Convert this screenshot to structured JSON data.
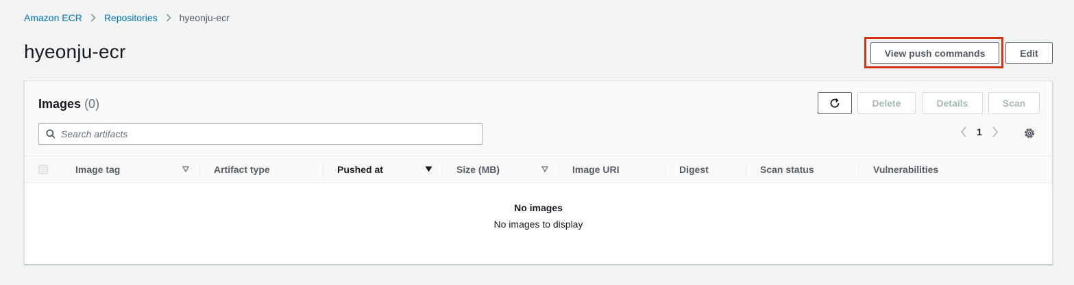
{
  "breadcrumb": [
    "Amazon ECR",
    "Repositories",
    "hyeonju-ecr"
  ],
  "page_title": "hyeonju-ecr",
  "actions": {
    "view_push_commands": "View push commands",
    "edit": "Edit"
  },
  "panel": {
    "title": "Images",
    "count": "(0)",
    "buttons": {
      "refresh": "refresh-icon",
      "delete": "Delete",
      "details": "Details",
      "scan": "Scan"
    },
    "search_placeholder": "Search artifacts",
    "pagination": {
      "page": "1"
    },
    "columns": [
      "Image tag",
      "Artifact type",
      "Pushed at",
      "Size (MB)",
      "Image URI",
      "Digest",
      "Scan status",
      "Vulnerabilities"
    ],
    "empty_title": "No images",
    "empty_text": "No images to display"
  },
  "colors": {
    "link": "#0073bb",
    "highlight": "#d13212",
    "background": "#f2f3f3"
  }
}
